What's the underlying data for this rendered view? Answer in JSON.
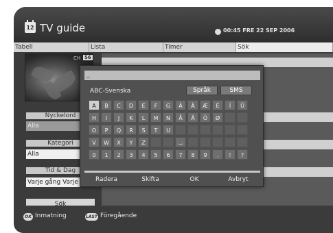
{
  "header": {
    "title": "TV guide",
    "title_icon": "calendar-icon",
    "title_icon_text": "12",
    "clock_icon": "clock-icon",
    "datetime": "00:45 FRE 22 SEP 2006"
  },
  "tabs": [
    {
      "label": "Tabell",
      "active": false
    },
    {
      "label": "Lista",
      "active": false
    },
    {
      "label": "Timer",
      "active": false
    },
    {
      "label": "Sök",
      "active": true
    }
  ],
  "preview": {
    "ch_label": "CH",
    "ch_number": "56"
  },
  "filters": {
    "keyword_label": "Nyckelord",
    "keyword_value": "Alla",
    "category_label": "Kategori",
    "category_value": "Alla",
    "time_label": "Tid & Dag",
    "time_value": "Varje gång Varje dag",
    "search_button": "Sök"
  },
  "keyboard": {
    "input_value": "_",
    "language": "ABC-Svenska",
    "lang_button": "Språk",
    "sms_button": "SMS",
    "rows": [
      [
        "A",
        "B",
        "C",
        "D",
        "E",
        "F",
        "G",
        "Á",
        "À",
        "Æ",
        "É",
        "Í",
        "Ü"
      ],
      [
        "H",
        "I",
        "J",
        "K",
        "L",
        "M",
        "N",
        "Å",
        "Ä",
        "Ö",
        "Ø",
        "",
        ""
      ],
      [
        "O",
        "P",
        "Q",
        "R",
        "S",
        "T",
        "U",
        "",
        "",
        "",
        "",
        "",
        ""
      ],
      [
        "V",
        "W",
        "X",
        "Y",
        "Z",
        "",
        "",
        " ",
        "",
        "",
        "",
        "",
        ""
      ],
      [
        "0",
        "1",
        "2",
        "3",
        "4",
        "5",
        "6",
        "7",
        "8",
        "9",
        ".",
        "!",
        "?"
      ]
    ],
    "space_symbol": "⌴",
    "selected_key": "A",
    "actions": [
      "Radera",
      "Skifta",
      "OK",
      "Avbryt"
    ]
  },
  "footer": {
    "ok_key": "OK",
    "ok_label": "Inmatning",
    "last_key": "LAST",
    "last_label": "Föregående"
  },
  "colors": {
    "frame": "#3b3b3b",
    "selected_key": "#d0d0d0",
    "key": "#6e6e6e"
  }
}
